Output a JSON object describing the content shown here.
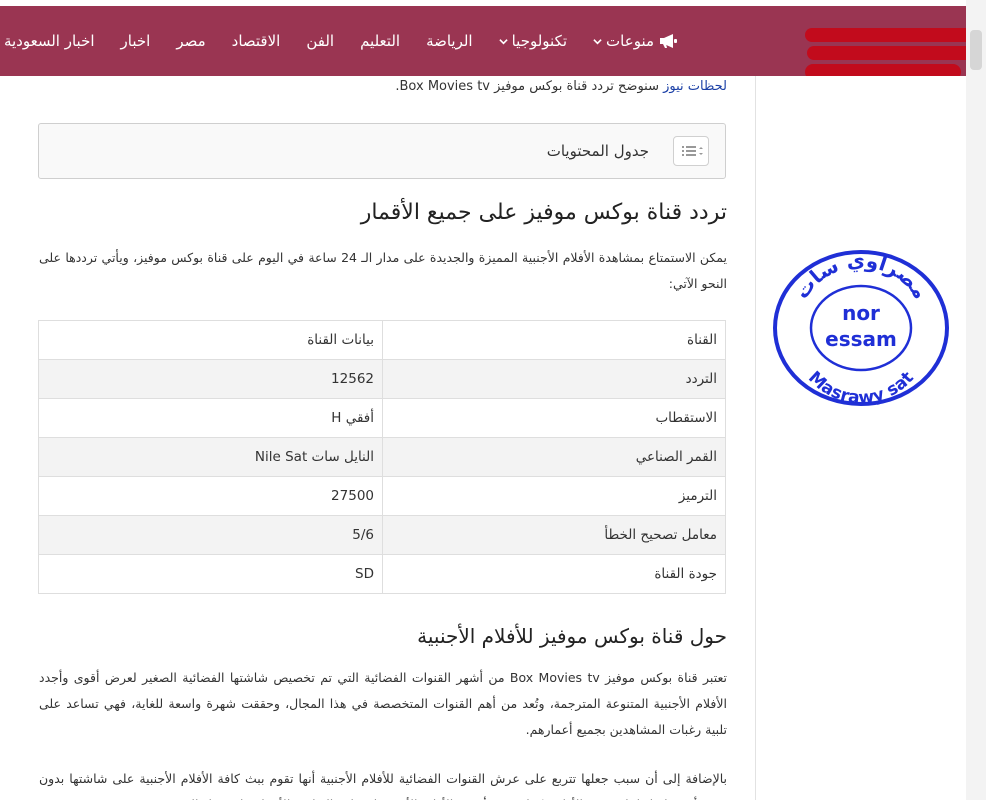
{
  "nav": {
    "items": [
      {
        "label": "اخبار السعودية",
        "dropdown": false
      },
      {
        "label": "اخبار",
        "dropdown": false
      },
      {
        "label": "مصر",
        "dropdown": false
      },
      {
        "label": "الاقتصاد",
        "dropdown": false
      },
      {
        "label": "الفن",
        "dropdown": false
      },
      {
        "label": "التعليم",
        "dropdown": false
      },
      {
        "label": "الرياضة",
        "dropdown": false
      },
      {
        "label": "تكنولوجيا",
        "dropdown": true
      },
      {
        "label": "منوعات",
        "dropdown": true
      }
    ]
  },
  "intro": {
    "link": "لحظات نيوز",
    "text": " سنوضح تردد قناة بوكس موفيز Box Movies tv."
  },
  "toc": {
    "title": "جدول المحتويات"
  },
  "section1": {
    "heading": "تردد قناة بوكس موفيز على جميع الأقمار",
    "paragraph": "يمكن الاستمتاع بمشاهدة الأفلام الأجنبية المميزة والجديدة على مدار الـ 24 ساعة في اليوم على قناة بوكس موفيز، ويأتي ترددها على النحو الآتي:"
  },
  "table": {
    "header": [
      "القناة",
      "بيانات القناة"
    ],
    "rows": [
      [
        "التردد",
        "12562"
      ],
      [
        "الاستقطاب",
        "أفقي H"
      ],
      [
        "القمر الصناعي",
        "النايل سات Nile Sat"
      ],
      [
        "الترميز",
        "27500"
      ],
      [
        "معامل تصحيح الخطأ",
        "5/6"
      ],
      [
        "جودة القناة",
        "SD"
      ]
    ]
  },
  "section2": {
    "heading": "حول قناة بوكس موفيز للأفلام الأجنبية",
    "paragraph1": "تعتبر قناة بوكس موفيز Box Movies tv من أشهر القنوات الفضائية التي تم تخصيص شاشتها الفضائية الصغير لعرض أقوى وأجدد الأفلام الأجنبية المتنوعة المترجمة، وتُعد من أهم القنوات المتخصصة في هذا المجال، وحققت شهرة واسعة للغاية، فهي تساعد على تلبية رغبات المشاهدين بجميع أعمارهم.",
    "paragraph2": "بالإضافة إلى أن سبب جعلها تتربع على عرش القنوات الفضائية للأفلام الأجنبية أنها تقوم ببث كافة الأفلام الأجنبية على شاشتها بدون وجود أي فواصل إعلانية بين الأفلام، كما تعرض أحدث الأفلام الأجنبية لمختلف الفئات والأعمار على مدار اليوم"
  },
  "stamp": {
    "top_text": "مصراوي سات",
    "line1": "nor",
    "line2": "essam",
    "bottom_text": "Masrawy sat"
  },
  "colors": {
    "navbar": "#9a3552",
    "stamp_blue": "#1f2fd6",
    "redaction": "#c20b1c"
  }
}
